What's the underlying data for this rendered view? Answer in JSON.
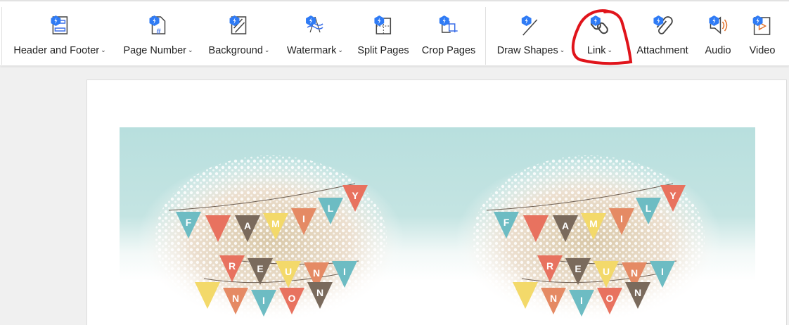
{
  "toolbar": {
    "items": [
      {
        "label": "Header and Footer",
        "dropdown": true,
        "icon": "header-footer-icon"
      },
      {
        "label": "Page Number",
        "dropdown": true,
        "icon": "page-number-icon"
      },
      {
        "label": "Background",
        "dropdown": true,
        "icon": "background-icon"
      },
      {
        "label": "Watermark",
        "dropdown": true,
        "icon": "watermark-icon"
      },
      {
        "label": "Split Pages",
        "dropdown": false,
        "icon": "split-pages-icon"
      },
      {
        "label": "Crop Pages",
        "dropdown": false,
        "icon": "crop-pages-icon"
      },
      {
        "label": "Draw Shapes",
        "dropdown": true,
        "icon": "draw-shapes-icon"
      },
      {
        "label": "Link",
        "dropdown": true,
        "icon": "link-icon"
      },
      {
        "label": "Attachment",
        "dropdown": false,
        "icon": "attachment-icon"
      },
      {
        "label": "Audio",
        "dropdown": false,
        "icon": "audio-icon"
      },
      {
        "label": "Video",
        "dropdown": false,
        "icon": "video-icon"
      }
    ],
    "chevron": "⌄",
    "accent": "#3b6fe8",
    "annotation_color": "#e0141b"
  },
  "document": {
    "banner_row1": [
      "F",
      "A",
      "M",
      "I",
      "L",
      "Y"
    ],
    "banner_row2": [
      "R",
      "E",
      "U",
      "N",
      "I",
      "O",
      "N"
    ]
  }
}
